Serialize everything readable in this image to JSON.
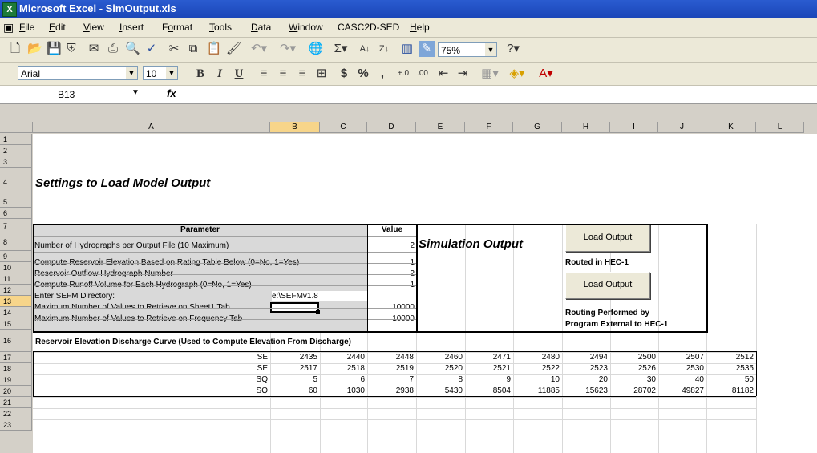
{
  "window": {
    "title": "Microsoft Excel - SimOutput.xls"
  },
  "menu": [
    {
      "u": "F",
      "rest": "ile"
    },
    {
      "u": "E",
      "rest": "dit"
    },
    {
      "u": "V",
      "rest": "iew"
    },
    {
      "u": "I",
      "rest": "nsert"
    },
    {
      "pre": "F",
      "u": "o",
      "rest": "rmat"
    },
    {
      "u": "T",
      "rest": "ools"
    },
    {
      "u": "D",
      "rest": "ata"
    },
    {
      "u": "W",
      "rest": "indow"
    },
    {
      "pre": "",
      "u": "",
      "rest": "CASC2D-SED"
    },
    {
      "u": "H",
      "rest": "elp"
    }
  ],
  "toolbar": {
    "zoom": "75%",
    "font": "Arial",
    "size": "10",
    "bold": "B",
    "italic": "I",
    "underline": "U",
    "currency": "$",
    "percent": "%",
    "comma": ","
  },
  "namebox": "B13",
  "fx": "fx",
  "columns": [
    "A",
    "B",
    "C",
    "D",
    "E",
    "F",
    "G",
    "H",
    "I",
    "J",
    "K",
    "L"
  ],
  "rows": [
    "1",
    "2",
    "3",
    "4",
    "5",
    "6",
    "7",
    "8",
    "9",
    "10",
    "11",
    "12",
    "13",
    "14",
    "15",
    "16",
    "17",
    "18",
    "19",
    "20",
    "21",
    "22",
    "23"
  ],
  "heading": "Settings to Load Model Output",
  "param_header": "Parameter",
  "value_header": "Value",
  "params": [
    {
      "label": "Number of Hydrographs per Output File (10 Maximum)",
      "value": "2"
    },
    {
      "label": "Compute Reservoir Elevation Based on Rating Table Below (0=No, 1=Yes)",
      "value": "1"
    },
    {
      "label": "Reservoir Outflow Hydrograph Number",
      "value": "2"
    },
    {
      "label": "Compute Runoff Volume for Each Hydrograph (0=No, 1=Yes)",
      "value": "1"
    },
    {
      "label": "Enter SEFM Directory:",
      "value": "e:\\SEFMv1.8"
    },
    {
      "label": "Maximum Number of Values to Retrieve on Sheet1 Tab",
      "value": "10000"
    },
    {
      "label": "Maximum Number of Values to Retrieve on Frequency Tab",
      "value": "10000"
    }
  ],
  "sim_output": "Simulation Output",
  "btn1": "Load Output",
  "routed": "Routed in HEC-1",
  "btn2": "Load Output",
  "routing1": "Routing Performed by",
  "routing2": "Program External to HEC-1",
  "curve_title": "Reservoir Elevation Discharge Curve (Used to Compute Elevation From Discharge)",
  "table": [
    {
      "label": "SE",
      "vals": [
        "2435",
        "2440",
        "2448",
        "2460",
        "2471",
        "2480",
        "2494",
        "2500",
        "2507",
        "2512"
      ]
    },
    {
      "label": "SE",
      "vals": [
        "2517",
        "2518",
        "2519",
        "2520",
        "2521",
        "2522",
        "2523",
        "2526",
        "2530",
        "2535"
      ]
    },
    {
      "label": "SQ",
      "vals": [
        "5",
        "6",
        "7",
        "8",
        "9",
        "10",
        "20",
        "30",
        "40",
        "50"
      ]
    },
    {
      "label": "SQ",
      "vals": [
        "60",
        "1030",
        "2938",
        "5430",
        "8504",
        "11885",
        "15623",
        "28702",
        "49827",
        "81182"
      ]
    }
  ]
}
